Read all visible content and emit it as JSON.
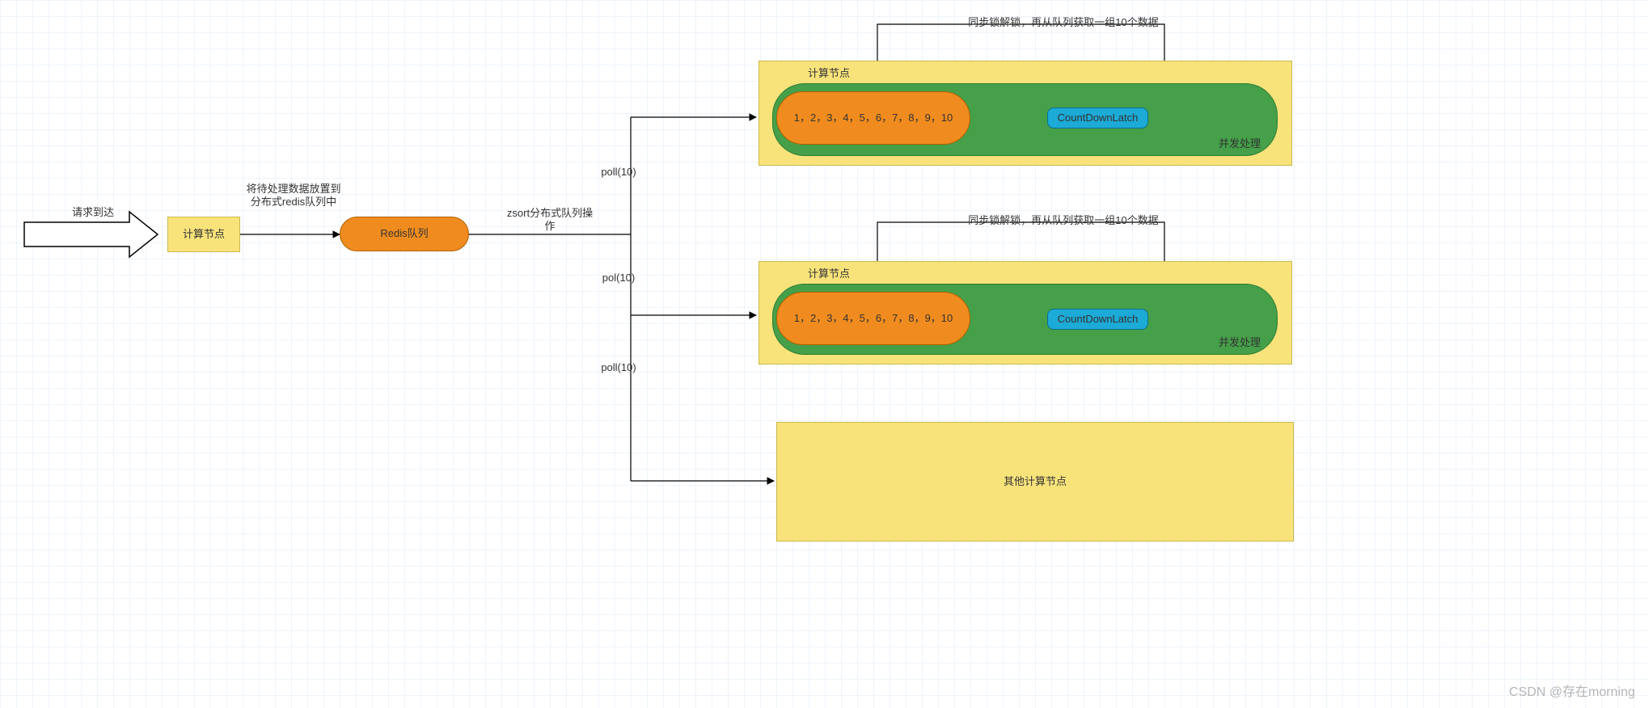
{
  "labels": {
    "request_arrow": "请求到达",
    "compute_node": "计算节点",
    "to_redis": "将待处理数据放置到\n分布式redis队列中",
    "redis_queue": "Redis队列",
    "zsort_ops": "zsort分布式队列操\n作",
    "poll_top": "poll(10)",
    "poll_mid": "pol(10)",
    "poll_bot": "poll(10)",
    "loop_back": "同步锁解锁，再从队列获取一组10个数据",
    "compute_node_title": "计算节点",
    "numbers": "1，2，3，4，5，6，7，8，9，10",
    "cdl": "CountDownLatch",
    "concurrent": "并发处理",
    "other_nodes": "其他计算节点",
    "watermark": "CSDN @存在morning"
  }
}
